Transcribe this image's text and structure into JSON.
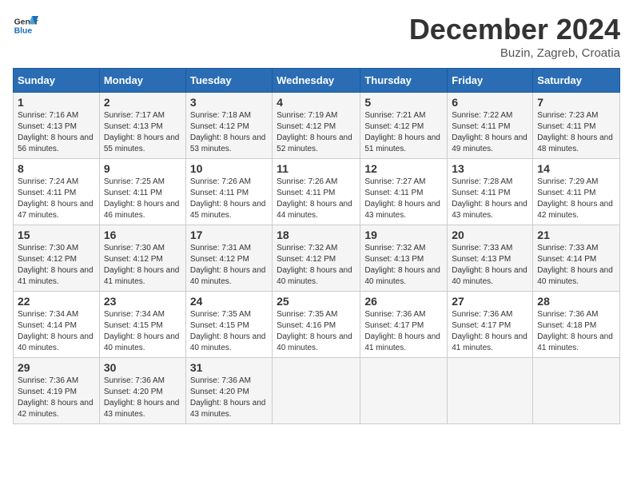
{
  "header": {
    "logo_general": "General",
    "logo_blue": "Blue",
    "month_title": "December 2024",
    "location": "Buzin, Zagreb, Croatia"
  },
  "weekdays": [
    "Sunday",
    "Monday",
    "Tuesday",
    "Wednesday",
    "Thursday",
    "Friday",
    "Saturday"
  ],
  "weeks": [
    [
      {
        "day": "1",
        "sunrise": "Sunrise: 7:16 AM",
        "sunset": "Sunset: 4:13 PM",
        "daylight": "Daylight: 8 hours and 56 minutes."
      },
      {
        "day": "2",
        "sunrise": "Sunrise: 7:17 AM",
        "sunset": "Sunset: 4:13 PM",
        "daylight": "Daylight: 8 hours and 55 minutes."
      },
      {
        "day": "3",
        "sunrise": "Sunrise: 7:18 AM",
        "sunset": "Sunset: 4:12 PM",
        "daylight": "Daylight: 8 hours and 53 minutes."
      },
      {
        "day": "4",
        "sunrise": "Sunrise: 7:19 AM",
        "sunset": "Sunset: 4:12 PM",
        "daylight": "Daylight: 8 hours and 52 minutes."
      },
      {
        "day": "5",
        "sunrise": "Sunrise: 7:21 AM",
        "sunset": "Sunset: 4:12 PM",
        "daylight": "Daylight: 8 hours and 51 minutes."
      },
      {
        "day": "6",
        "sunrise": "Sunrise: 7:22 AM",
        "sunset": "Sunset: 4:11 PM",
        "daylight": "Daylight: 8 hours and 49 minutes."
      },
      {
        "day": "7",
        "sunrise": "Sunrise: 7:23 AM",
        "sunset": "Sunset: 4:11 PM",
        "daylight": "Daylight: 8 hours and 48 minutes."
      }
    ],
    [
      {
        "day": "8",
        "sunrise": "Sunrise: 7:24 AM",
        "sunset": "Sunset: 4:11 PM",
        "daylight": "Daylight: 8 hours and 47 minutes."
      },
      {
        "day": "9",
        "sunrise": "Sunrise: 7:25 AM",
        "sunset": "Sunset: 4:11 PM",
        "daylight": "Daylight: 8 hours and 46 minutes."
      },
      {
        "day": "10",
        "sunrise": "Sunrise: 7:26 AM",
        "sunset": "Sunset: 4:11 PM",
        "daylight": "Daylight: 8 hours and 45 minutes."
      },
      {
        "day": "11",
        "sunrise": "Sunrise: 7:26 AM",
        "sunset": "Sunset: 4:11 PM",
        "daylight": "Daylight: 8 hours and 44 minutes."
      },
      {
        "day": "12",
        "sunrise": "Sunrise: 7:27 AM",
        "sunset": "Sunset: 4:11 PM",
        "daylight": "Daylight: 8 hours and 43 minutes."
      },
      {
        "day": "13",
        "sunrise": "Sunrise: 7:28 AM",
        "sunset": "Sunset: 4:11 PM",
        "daylight": "Daylight: 8 hours and 43 minutes."
      },
      {
        "day": "14",
        "sunrise": "Sunrise: 7:29 AM",
        "sunset": "Sunset: 4:11 PM",
        "daylight": "Daylight: 8 hours and 42 minutes."
      }
    ],
    [
      {
        "day": "15",
        "sunrise": "Sunrise: 7:30 AM",
        "sunset": "Sunset: 4:12 PM",
        "daylight": "Daylight: 8 hours and 41 minutes."
      },
      {
        "day": "16",
        "sunrise": "Sunrise: 7:30 AM",
        "sunset": "Sunset: 4:12 PM",
        "daylight": "Daylight: 8 hours and 41 minutes."
      },
      {
        "day": "17",
        "sunrise": "Sunrise: 7:31 AM",
        "sunset": "Sunset: 4:12 PM",
        "daylight": "Daylight: 8 hours and 40 minutes."
      },
      {
        "day": "18",
        "sunrise": "Sunrise: 7:32 AM",
        "sunset": "Sunset: 4:12 PM",
        "daylight": "Daylight: 8 hours and 40 minutes."
      },
      {
        "day": "19",
        "sunrise": "Sunrise: 7:32 AM",
        "sunset": "Sunset: 4:13 PM",
        "daylight": "Daylight: 8 hours and 40 minutes."
      },
      {
        "day": "20",
        "sunrise": "Sunrise: 7:33 AM",
        "sunset": "Sunset: 4:13 PM",
        "daylight": "Daylight: 8 hours and 40 minutes."
      },
      {
        "day": "21",
        "sunrise": "Sunrise: 7:33 AM",
        "sunset": "Sunset: 4:14 PM",
        "daylight": "Daylight: 8 hours and 40 minutes."
      }
    ],
    [
      {
        "day": "22",
        "sunrise": "Sunrise: 7:34 AM",
        "sunset": "Sunset: 4:14 PM",
        "daylight": "Daylight: 8 hours and 40 minutes."
      },
      {
        "day": "23",
        "sunrise": "Sunrise: 7:34 AM",
        "sunset": "Sunset: 4:15 PM",
        "daylight": "Daylight: 8 hours and 40 minutes."
      },
      {
        "day": "24",
        "sunrise": "Sunrise: 7:35 AM",
        "sunset": "Sunset: 4:15 PM",
        "daylight": "Daylight: 8 hours and 40 minutes."
      },
      {
        "day": "25",
        "sunrise": "Sunrise: 7:35 AM",
        "sunset": "Sunset: 4:16 PM",
        "daylight": "Daylight: 8 hours and 40 minutes."
      },
      {
        "day": "26",
        "sunrise": "Sunrise: 7:36 AM",
        "sunset": "Sunset: 4:17 PM",
        "daylight": "Daylight: 8 hours and 41 minutes."
      },
      {
        "day": "27",
        "sunrise": "Sunrise: 7:36 AM",
        "sunset": "Sunset: 4:17 PM",
        "daylight": "Daylight: 8 hours and 41 minutes."
      },
      {
        "day": "28",
        "sunrise": "Sunrise: 7:36 AM",
        "sunset": "Sunset: 4:18 PM",
        "daylight": "Daylight: 8 hours and 41 minutes."
      }
    ],
    [
      {
        "day": "29",
        "sunrise": "Sunrise: 7:36 AM",
        "sunset": "Sunset: 4:19 PM",
        "daylight": "Daylight: 8 hours and 42 minutes."
      },
      {
        "day": "30",
        "sunrise": "Sunrise: 7:36 AM",
        "sunset": "Sunset: 4:20 PM",
        "daylight": "Daylight: 8 hours and 43 minutes."
      },
      {
        "day": "31",
        "sunrise": "Sunrise: 7:36 AM",
        "sunset": "Sunset: 4:20 PM",
        "daylight": "Daylight: 8 hours and 43 minutes."
      },
      null,
      null,
      null,
      null
    ]
  ]
}
